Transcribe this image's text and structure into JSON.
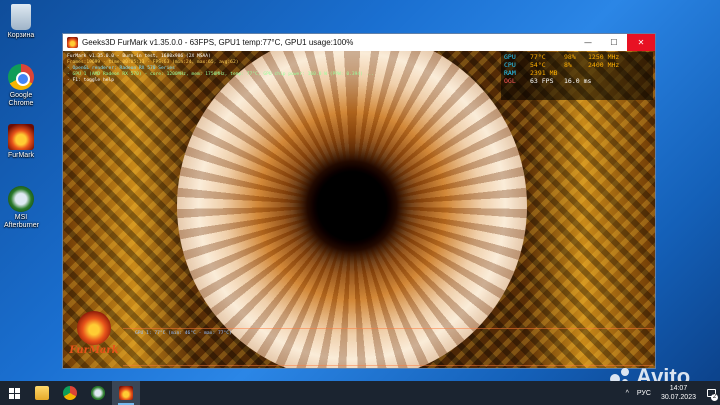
{
  "desktop": {
    "icons": [
      {
        "label": "Корзина",
        "icon": "recycle-bin-icon"
      },
      {
        "label": "Google Chrome",
        "icon": "chrome-icon"
      },
      {
        "label": "FurMark",
        "icon": "furmark-icon"
      },
      {
        "label": "MSI Afterburner",
        "icon": "msi-afterburner-icon"
      }
    ]
  },
  "window": {
    "title": "Geeks3D FurMark v1.35.0.0 - 63FPS, GPU1 temp:77°C, GPU1 usage:100%",
    "controls": {
      "minimize": "—",
      "maximize": "☐",
      "close": "✕"
    },
    "hud": {
      "line1": "FurMark v1.35.0.0 - Burn-in test, 1680x986 (2X MSAA)",
      "line2": "Frames:19699 - time:00:05:13 - FPS:63 (min:24, max:65, avg:62)",
      "line3": "- OpenGL renderer: Radeon RX 570 Series",
      "line4": "- GPU 1 (AMD Radeon RX 570) - core: 1200MHz, mem: 1750MHz, temp: 77°C, GPU chip power: 160.0 W (PPW: 0.394) ...",
      "line5": "- F1: toggle help"
    },
    "osd": {
      "gpu": {
        "label": "GPU",
        "temp": "77",
        "temp_unit": "°C",
        "load": "98",
        "load_unit": "%",
        "clock": "1250",
        "clock_unit": "MHz"
      },
      "cpu": {
        "label": "CPU",
        "temp": "54",
        "temp_unit": "°C",
        "load": "8",
        "load_unit": "%",
        "clock": "2400",
        "clock_unit": "MHz"
      },
      "ram": {
        "label": "RAM",
        "value": "2391",
        "unit": "MB"
      },
      "ogl": {
        "label": "OGL",
        "fps": "63",
        "fps_unit": "FPS",
        "frametime": "16.0",
        "frametime_unit": "ms"
      }
    },
    "graph_legend": "GPU 1: 77°C (min: 46°C - max: 77°C)",
    "logo_text": "FurMark"
  },
  "taskbar": {
    "apps": [
      {
        "name": "file-explorer",
        "icon": "folder-icon",
        "open": false
      },
      {
        "name": "chrome",
        "icon": "chrome-icon",
        "open": false
      },
      {
        "name": "msi-afterburner",
        "icon": "msi-afterburner-icon",
        "open": false
      },
      {
        "name": "furmark",
        "icon": "furmark-icon",
        "open": true
      }
    ],
    "tray": {
      "chevron": "^",
      "language": "РУС",
      "time": "14:07",
      "date": "30.07.2023",
      "notifications": "2"
    }
  },
  "watermark": "Avito"
}
